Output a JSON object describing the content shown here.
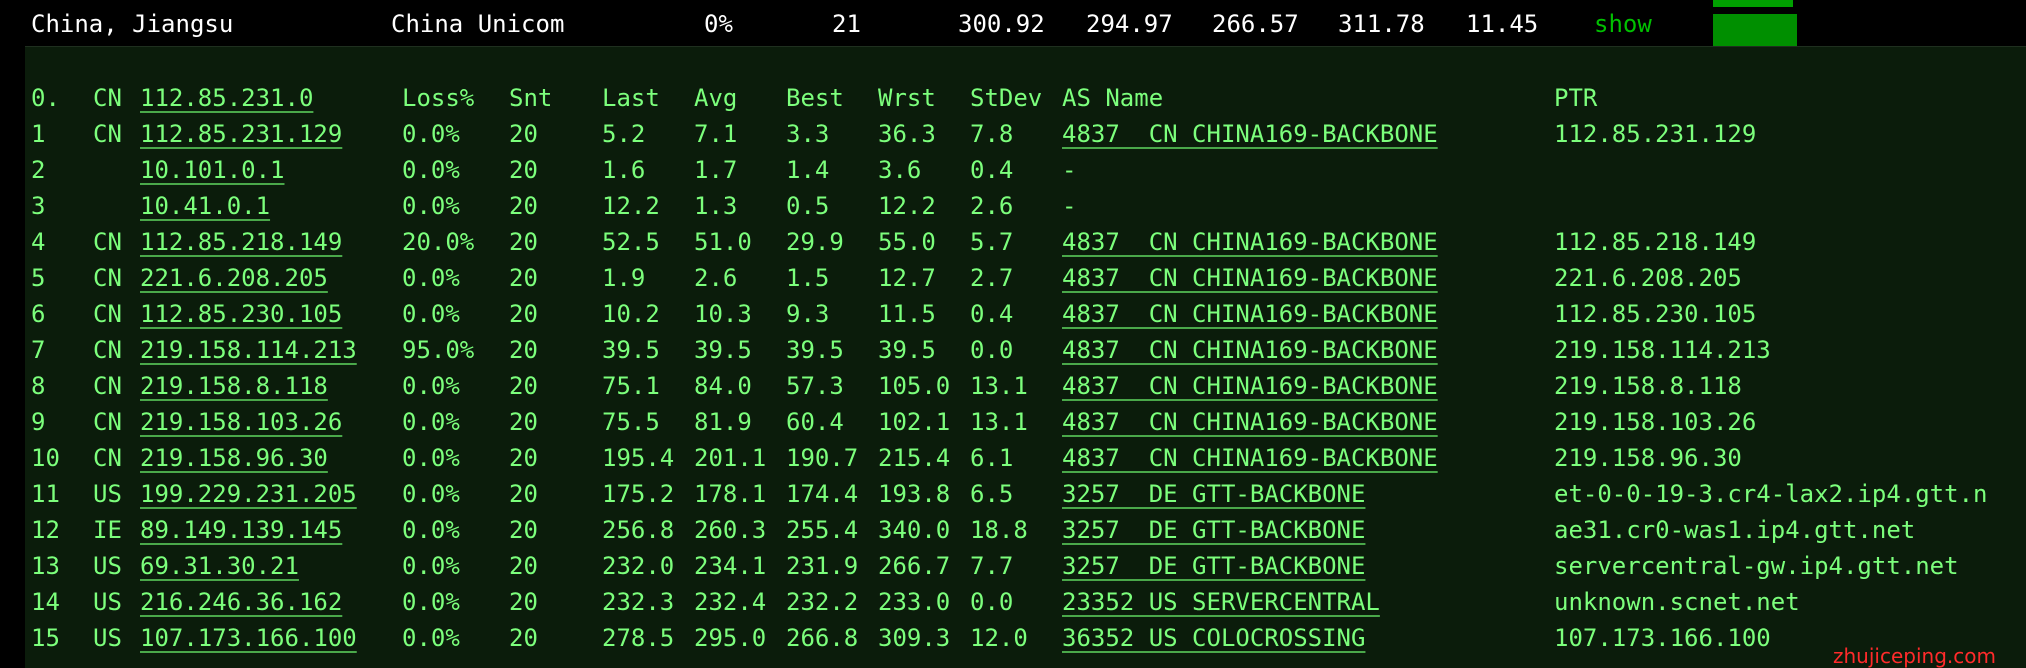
{
  "summary_row": {
    "location": "China, Jiangsu",
    "isp": "China Unicom",
    "loss": "0%",
    "hops": "21",
    "last": "300.92",
    "avg": "294.97",
    "best": "266.57",
    "worst": "311.78",
    "stdev": "11.45",
    "show_link": "show"
  },
  "header": {
    "hop": "0.",
    "cc": "CN",
    "host": "112.85.231.0",
    "loss": "Loss%",
    "snt": "Snt",
    "last": "Last",
    "avg": "Avg",
    "best": "Best",
    "wrst": "Wrst",
    "stdev": "StDev",
    "as_name": "AS Name",
    "ptr": "PTR"
  },
  "hops": [
    {
      "hop": "1",
      "cc": "CN",
      "host": "112.85.231.129",
      "loss": "0.0%",
      "snt": "20",
      "last": "5.2",
      "avg": "7.1",
      "best": "3.3",
      "wrst": "36.3",
      "stdev": "7.8",
      "as_name": "4837  CN CHINA169-BACKBONE",
      "ptr": "112.85.231.129"
    },
    {
      "hop": "2",
      "cc": "",
      "host": "10.101.0.1",
      "loss": "0.0%",
      "snt": "20",
      "last": "1.6",
      "avg": "1.7",
      "best": "1.4",
      "wrst": "3.6",
      "stdev": "0.4",
      "as_name": "-",
      "ptr": ""
    },
    {
      "hop": "3",
      "cc": "",
      "host": "10.41.0.1",
      "loss": "0.0%",
      "snt": "20",
      "last": "12.2",
      "avg": "1.3",
      "best": "0.5",
      "wrst": "12.2",
      "stdev": "2.6",
      "as_name": "-",
      "ptr": ""
    },
    {
      "hop": "4",
      "cc": "CN",
      "host": "112.85.218.149",
      "loss": "20.0%",
      "snt": "20",
      "last": "52.5",
      "avg": "51.0",
      "best": "29.9",
      "wrst": "55.0",
      "stdev": "5.7",
      "as_name": "4837  CN CHINA169-BACKBONE",
      "ptr": "112.85.218.149"
    },
    {
      "hop": "5",
      "cc": "CN",
      "host": "221.6.208.205",
      "loss": "0.0%",
      "snt": "20",
      "last": "1.9",
      "avg": "2.6",
      "best": "1.5",
      "wrst": "12.7",
      "stdev": "2.7",
      "as_name": "4837  CN CHINA169-BACKBONE",
      "ptr": "221.6.208.205"
    },
    {
      "hop": "6",
      "cc": "CN",
      "host": "112.85.230.105",
      "loss": "0.0%",
      "snt": "20",
      "last": "10.2",
      "avg": "10.3",
      "best": "9.3",
      "wrst": "11.5",
      "stdev": "0.4",
      "as_name": "4837  CN CHINA169-BACKBONE",
      "ptr": "112.85.230.105"
    },
    {
      "hop": "7",
      "cc": "CN",
      "host": "219.158.114.213",
      "loss": "95.0%",
      "snt": "20",
      "last": "39.5",
      "avg": "39.5",
      "best": "39.5",
      "wrst": "39.5",
      "stdev": "0.0",
      "as_name": "4837  CN CHINA169-BACKBONE",
      "ptr": "219.158.114.213"
    },
    {
      "hop": "8",
      "cc": "CN",
      "host": "219.158.8.118",
      "loss": "0.0%",
      "snt": "20",
      "last": "75.1",
      "avg": "84.0",
      "best": "57.3",
      "wrst": "105.0",
      "stdev": "13.1",
      "as_name": "4837  CN CHINA169-BACKBONE",
      "ptr": "219.158.8.118"
    },
    {
      "hop": "9",
      "cc": "CN",
      "host": "219.158.103.26",
      "loss": "0.0%",
      "snt": "20",
      "last": "75.5",
      "avg": "81.9",
      "best": "60.4",
      "wrst": "102.1",
      "stdev": "13.1",
      "as_name": "4837  CN CHINA169-BACKBONE",
      "ptr": "219.158.103.26"
    },
    {
      "hop": "10",
      "cc": "CN",
      "host": "219.158.96.30",
      "loss": "0.0%",
      "snt": "20",
      "last": "195.4",
      "avg": "201.1",
      "best": "190.7",
      "wrst": "215.4",
      "stdev": "6.1",
      "as_name": "4837  CN CHINA169-BACKBONE",
      "ptr": "219.158.96.30"
    },
    {
      "hop": "11",
      "cc": "US",
      "host": "199.229.231.205",
      "loss": "0.0%",
      "snt": "20",
      "last": "175.2",
      "avg": "178.1",
      "best": "174.4",
      "wrst": "193.8",
      "stdev": "6.5",
      "as_name": "3257  DE GTT-BACKBONE",
      "ptr": "et-0-0-19-3.cr4-lax2.ip4.gtt.n"
    },
    {
      "hop": "12",
      "cc": "IE",
      "host": "89.149.139.145",
      "loss": "0.0%",
      "snt": "20",
      "last": "256.8",
      "avg": "260.3",
      "best": "255.4",
      "wrst": "340.0",
      "stdev": "18.8",
      "as_name": "3257  DE GTT-BACKBONE",
      "ptr": "ae31.cr0-was1.ip4.gtt.net"
    },
    {
      "hop": "13",
      "cc": "US",
      "host": "69.31.30.21",
      "loss": "0.0%",
      "snt": "20",
      "last": "232.0",
      "avg": "234.1",
      "best": "231.9",
      "wrst": "266.7",
      "stdev": "7.7",
      "as_name": "3257  DE GTT-BACKBONE",
      "ptr": "servercentral-gw.ip4.gtt.net"
    },
    {
      "hop": "14",
      "cc": "US",
      "host": "216.246.36.162",
      "loss": "0.0%",
      "snt": "20",
      "last": "232.3",
      "avg": "232.4",
      "best": "232.2",
      "wrst": "233.0",
      "stdev": "0.0",
      "as_name": "23352 US SERVERCENTRAL",
      "ptr": "unknown.scnet.net"
    },
    {
      "hop": "15",
      "cc": "US",
      "host": "107.173.166.100",
      "loss": "0.0%",
      "snt": "20",
      "last": "278.5",
      "avg": "295.0",
      "best": "266.8",
      "wrst": "309.3",
      "stdev": "12.0",
      "as_name": "36352 US COLOCROSSING",
      "ptr": "107.173.166.100"
    }
  ],
  "watermark": "zhujiceping.com"
}
